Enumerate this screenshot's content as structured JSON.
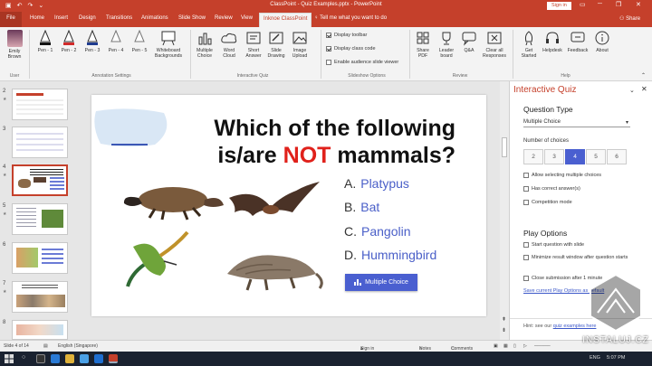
{
  "window": {
    "title": "ClassPoint - Quiz Examples.pptx - PowerPoint",
    "sign_in": "Sign in",
    "share": "Share"
  },
  "tabs": [
    "File",
    "Home",
    "Insert",
    "Design",
    "Transitions",
    "Animations",
    "Slide Show",
    "Review",
    "View",
    "Inknoe ClassPoint"
  ],
  "tell_me": "Tell me what you want to do",
  "ribbon": {
    "user": {
      "name_line1": "Emily",
      "name_line2": "Brown",
      "group": "User"
    },
    "pens": [
      "Pen - 1",
      "Pen - 2",
      "Pen - 3",
      "Pen - 4",
      "Pen - 5"
    ],
    "whiteboard": [
      "Whiteboard",
      "Backgrounds"
    ],
    "annotation_group": "Annotation Settings",
    "quiz_buttons": [
      {
        "l1": "Multiple",
        "l2": "Choice"
      },
      {
        "l1": "Word",
        "l2": "Cloud"
      },
      {
        "l1": "Short",
        "l2": "Answer"
      },
      {
        "l1": "Slide",
        "l2": "Drawing"
      },
      {
        "l1": "Image",
        "l2": "Upload"
      }
    ],
    "quiz_group": "Interactive Quiz",
    "slideshow_options": [
      "Display toolbar",
      "Display class code",
      "Enable audience slide viewer"
    ],
    "slideshow_group": "Slideshow Options",
    "review_buttons": [
      {
        "l1": "Share",
        "l2": "PDF"
      },
      {
        "l1": "Leader",
        "l2": "board"
      },
      {
        "l1": "Q&A",
        "l2": ""
      },
      {
        "l1": "Clear all",
        "l2": "Responses"
      }
    ],
    "review_group": "Review",
    "help_buttons": [
      {
        "l1": "Get",
        "l2": "Started"
      },
      {
        "l1": "Helpdesk",
        "l2": ""
      },
      {
        "l1": "Feedback",
        "l2": ""
      },
      {
        "l1": "About",
        "l2": ""
      }
    ],
    "help_group": "Help"
  },
  "thumbnails": [
    {
      "num": "2",
      "star": "★"
    },
    {
      "num": "3",
      "star": ""
    },
    {
      "num": "4",
      "star": "★"
    },
    {
      "num": "5",
      "star": "★"
    },
    {
      "num": "6",
      "star": ""
    },
    {
      "num": "7",
      "star": "★"
    },
    {
      "num": "8",
      "star": ""
    }
  ],
  "slide": {
    "title_line1": "Which of the following",
    "title_line2_pre": "is/are ",
    "title_line2_em": "NOT",
    "title_line2_post": " mammals?",
    "options": [
      {
        "letter": "A.",
        "text": "Platypus"
      },
      {
        "letter": "B.",
        "text": "Bat"
      },
      {
        "letter": "C.",
        "text": "Pangolin"
      },
      {
        "letter": "D.",
        "text": "Hummingbird"
      }
    ],
    "button": "Multiple Choice"
  },
  "panel": {
    "title": "Interactive Quiz",
    "question_type_label": "Question Type",
    "question_type_value": "Multiple Choice",
    "num_choices_label": "Number of choices",
    "choices": [
      "2",
      "3",
      "4",
      "5",
      "6"
    ],
    "selected_choice": "4",
    "checkboxes": [
      "Allow selecting multiple choices",
      "Has correct answer(s)",
      "Competition mode"
    ],
    "play_options_label": "Play Options",
    "play_checkboxes": [
      "Start question with slide",
      "Minimize result window after question starts",
      "Close submission after 1 minute"
    ],
    "save_link": "Save current Play Options as default",
    "hint_pre": "Hint: see our ",
    "hint_link": "quiz examples here"
  },
  "status": {
    "slide": "Slide 4 of 14",
    "language": "English (Singapore)",
    "signin": "Sign in Required",
    "notes": "Notes",
    "comments": "Comments",
    "zoom": "─────"
  },
  "taskbar": {
    "lang": "ENG",
    "time": "5:07 PM"
  },
  "watermark": "INSTALUJ.CZ",
  "colors": {
    "accent": "#c5402b",
    "quiz_blue": "#4a5fd0"
  }
}
